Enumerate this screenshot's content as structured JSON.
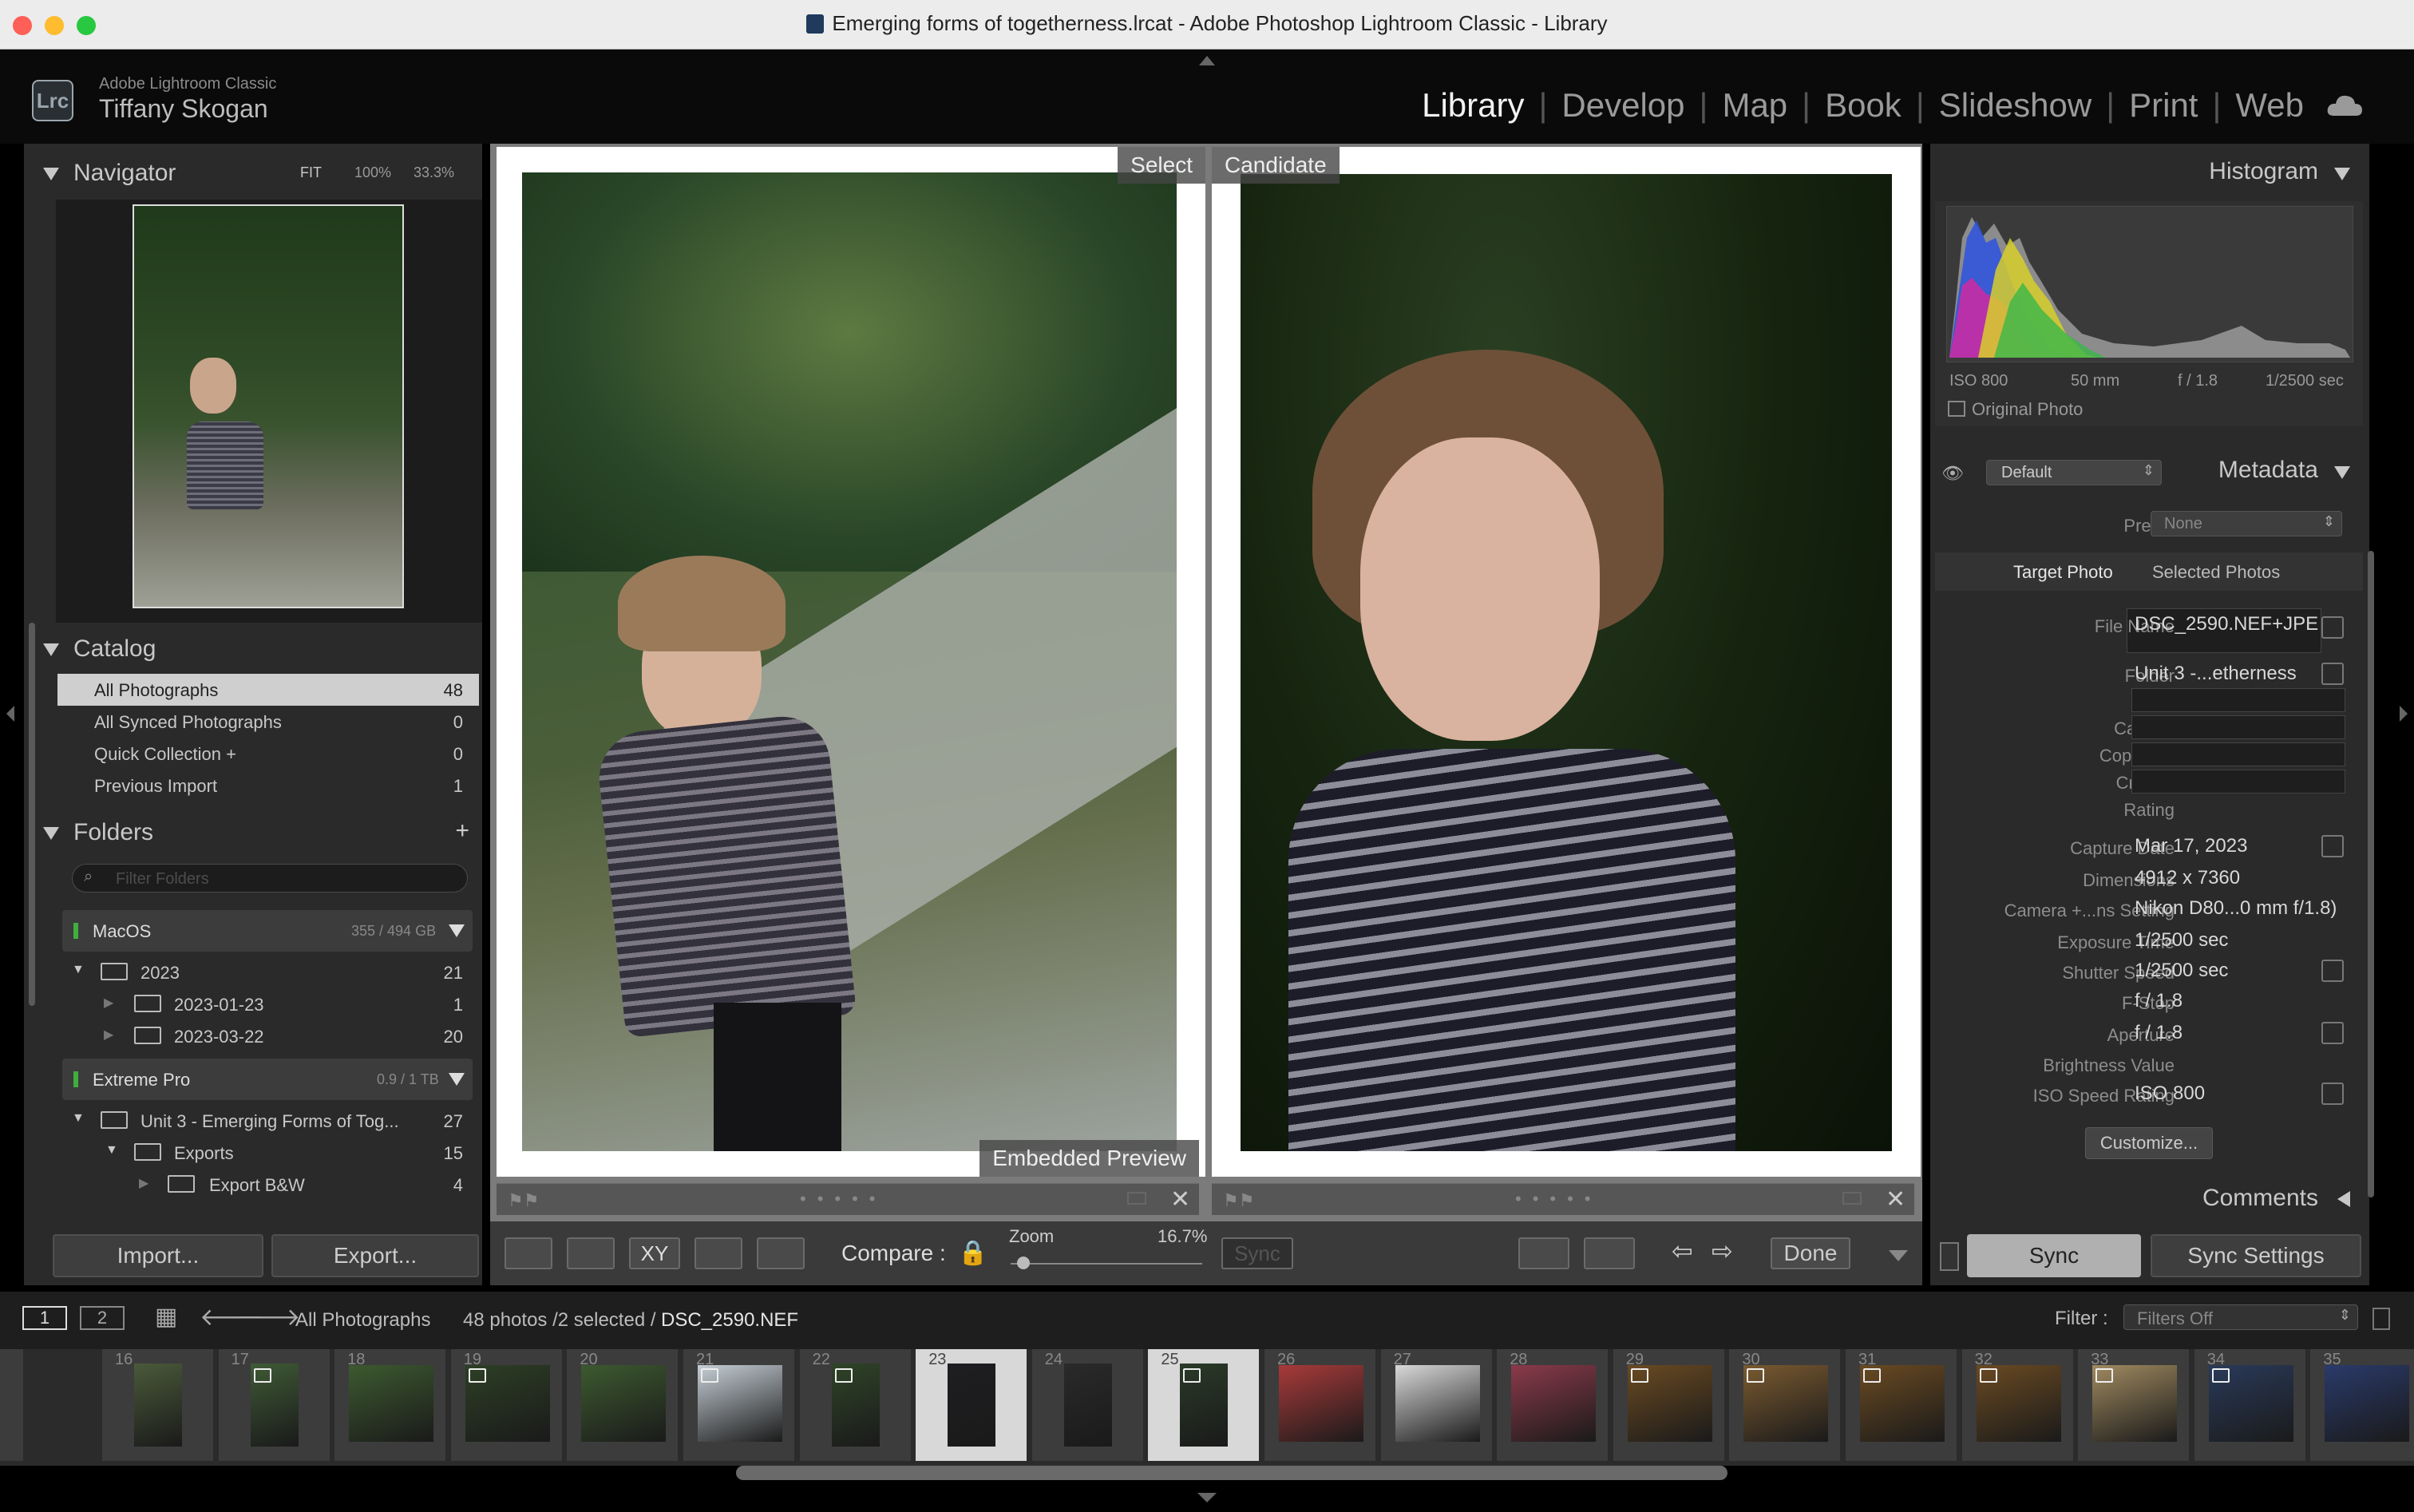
{
  "window": {
    "title": "Emerging forms of togetherness.lrcat - Adobe Photoshop Lightroom Classic - Library"
  },
  "identity": {
    "app": "Adobe Lightroom Classic",
    "user": "Tiffany Skogan",
    "logo": "Lrc"
  },
  "modules": [
    "Library",
    "Develop",
    "Map",
    "Book",
    "Slideshow",
    "Print",
    "Web"
  ],
  "navigator": {
    "title": "Navigator",
    "zoom_opts": [
      "FIT",
      "100%",
      "33.3%"
    ]
  },
  "catalog": {
    "title": "Catalog",
    "items": [
      {
        "label": "All Photographs",
        "count": "48"
      },
      {
        "label": "All Synced Photographs",
        "count": "0"
      },
      {
        "label": "Quick Collection +",
        "count": "0"
      },
      {
        "label": "Previous Import",
        "count": "1"
      }
    ]
  },
  "folders": {
    "title": "Folders",
    "filter_placeholder": "Filter Folders",
    "volumes": [
      {
        "name": "MacOS",
        "size": "355 / 494 GB"
      },
      {
        "name": "Extreme Pro",
        "size": "0.9 / 1 TB"
      }
    ],
    "tree": [
      {
        "label": "2023",
        "count": "21"
      },
      {
        "label": "2023-01-23",
        "count": "1"
      },
      {
        "label": "2023-03-22",
        "count": "20"
      },
      {
        "label": "Unit 3 - Emerging Forms of Tog...",
        "count": "27"
      },
      {
        "label": "Exports",
        "count": "15"
      },
      {
        "label": "Export B&W",
        "count": "4"
      }
    ]
  },
  "left_buttons": {
    "import": "Import...",
    "export": "Export..."
  },
  "compare": {
    "select_label": "Select",
    "candidate_label": "Candidate",
    "preview_label": "Embedded Preview",
    "compare_label": "Compare :",
    "zoom_label": "Zoom",
    "zoom_value": "16.7%",
    "sync": "Sync",
    "done": "Done"
  },
  "histogram": {
    "title": "Histogram",
    "iso": "ISO 800",
    "focal": "50 mm",
    "fstop": "f / 1.8",
    "shutter": "1/2500 sec",
    "original": "Original Photo"
  },
  "metadata": {
    "title": "Metadata",
    "preset_set": "Default",
    "preset_label": "Preset",
    "preset_value": "None",
    "tabs": [
      "Target Photo",
      "Selected Photos"
    ],
    "fields": [
      {
        "label": "File Name",
        "value": "DSC_2590.NEF+JPE"
      },
      {
        "label": "Folder",
        "value": "Unit 3 -...etherness"
      },
      {
        "label": "Title",
        "value": ""
      },
      {
        "label": "Caption",
        "value": ""
      },
      {
        "label": "Copyright",
        "value": ""
      },
      {
        "label": "Creator",
        "value": ""
      },
      {
        "label": "Rating",
        "value": ""
      },
      {
        "label": "Capture Date",
        "value": "Mar 17, 2023"
      },
      {
        "label": "Dimensions",
        "value": "4912 x 7360"
      },
      {
        "label": "Camera +...ns Setting",
        "value": "Nikon D80...0 mm f/1.8)"
      },
      {
        "label": "Exposure Time",
        "value": "1/2500 sec"
      },
      {
        "label": "Shutter Speed",
        "value": "1/2500 sec"
      },
      {
        "label": "F-Stop",
        "value": "f / 1.8"
      },
      {
        "label": "Aperture",
        "value": "f / 1.8"
      },
      {
        "label": "Brightness Value",
        "value": ""
      },
      {
        "label": "ISO Speed Rating",
        "value": "ISO 800"
      }
    ],
    "customize": "Customize..."
  },
  "comments": {
    "title": "Comments"
  },
  "right_buttons": {
    "sync": "Sync",
    "sync_settings": "Sync Settings"
  },
  "filmstrip": {
    "screen1": "1",
    "screen2": "2",
    "source": "All Photographs",
    "info": "48 photos /2 selected /",
    "file": "DSC_2590.NEF",
    "filter_label": "Filter :",
    "filter_value": "Filters Off",
    "cells": [
      "",
      "16",
      "17",
      "18",
      "19",
      "20",
      "21",
      "22",
      "23",
      "24",
      "25",
      "26",
      "27",
      "28",
      "29",
      "30",
      "31",
      "32",
      "33",
      "34",
      "35"
    ]
  },
  "colors": {
    "accent_sync": "#b0b0b0",
    "volume_green": "#3fae3f"
  }
}
